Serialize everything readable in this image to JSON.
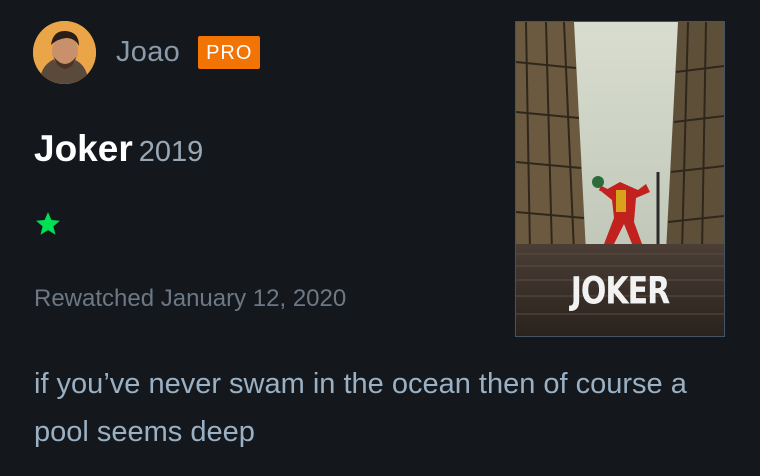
{
  "review": {
    "author": {
      "name": "Joao",
      "badge": "PRO"
    },
    "film": {
      "title": "Joker",
      "year": "2019",
      "poster_title": "JOKER"
    },
    "rating": {
      "stars": 1,
      "max": 5,
      "color": "#00e054"
    },
    "watch_status": "Rewatched January 12, 2020",
    "text": "if you’ve never swam in the ocean then of course a pool seems deep"
  },
  "colors": {
    "background": "#14181c",
    "badge": "#f27405",
    "username": "#8a9aaa",
    "review_text": "#9ab0c4"
  }
}
